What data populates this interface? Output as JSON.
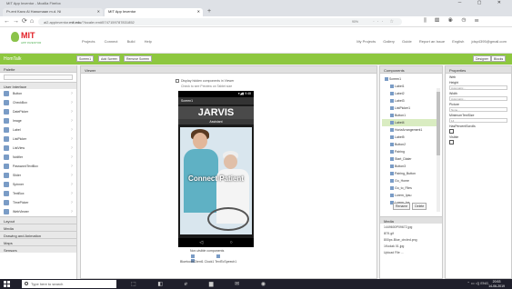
{
  "browser": {
    "window_title": "MIT App Inventor - Mozilla Firefox",
    "tabs": [
      {
        "label": "Pr-ent Kavo Al Hanumaan m.d. Ni"
      },
      {
        "label": "MIT App Inventor"
      }
    ],
    "url_prefix": "ai2.appinventor.",
    "url_domain": "mit.edu",
    "url_suffix": "/?locale=en#5747159787831852",
    "url_badge": "90%"
  },
  "header": {
    "logo_title": "MIT",
    "logo_subtitle": "APP INVENTOR",
    "menus": [
      "Projects",
      "Connect",
      "Build",
      "Help"
    ],
    "right_links": [
      "My Projects",
      "Gallery",
      "Guide",
      "Report an Issue",
      "English",
      "jdsp4395@gmail.com"
    ]
  },
  "project_bar": {
    "project_name": "HomTalk",
    "buttons": [
      "Screen1",
      "Add Screen",
      "Remove Screen",
      "Designer",
      "Blocks"
    ]
  },
  "palette": {
    "title": "Palette",
    "category": "User Interface",
    "items": [
      {
        "label": "Button"
      },
      {
        "label": "CheckBox"
      },
      {
        "label": "DatePicker"
      },
      {
        "label": "Image"
      },
      {
        "label": "Label"
      },
      {
        "label": "ListPicker"
      },
      {
        "label": "ListView"
      },
      {
        "label": "Notifier"
      },
      {
        "label": "PasswordTextBox"
      },
      {
        "label": "Slider"
      },
      {
        "label": "Spinner"
      },
      {
        "label": "TextBox"
      },
      {
        "label": "TimePicker"
      },
      {
        "label": "WebViewer"
      }
    ],
    "categories_below": [
      "Layout",
      "Media",
      "Drawing and Animation",
      "Maps",
      "Sensors"
    ]
  },
  "viewer": {
    "title": "Viewer",
    "checkbox_label": "Display hidden components in Viewer",
    "size_label": "Check to see Preview on Tablet size",
    "status_time": "9:48",
    "screen_title": "Screen1",
    "heading": "JARVIS",
    "subheading": "Assistant",
    "image_caption": "Connect Patient",
    "nonvisible_title": "Non-visible components",
    "nonvisible_items": "BluetoothClient1  Clock1  TextToSpeech1"
  },
  "components": {
    "title": "Components",
    "root": "Screen1",
    "items": [
      "Label1",
      "Label2",
      "Label3",
      "ListPicker1",
      "Button1",
      "Label4",
      "HorizArrangement1",
      "Label5",
      "Button2",
      "Pairing",
      "Start_Dialer",
      "Button3",
      "Pairing_Button",
      "Go_Home",
      "Go_to_Files",
      "Lorem_Ipsu",
      "Lorem_Ips"
    ],
    "selected_index": 5,
    "rename_label": "Rename",
    "delete_label": "Delete",
    "media_title": "Media",
    "media_items": [
      "1449600P09672.jpg",
      "lll79.gif",
      "800px-Blue_circled.png",
      "1Kodak 01.jpg",
      "Upload File ..."
    ]
  },
  "properties": {
    "title": "Properties",
    "component": "Web",
    "fields": [
      {
        "label": "Height",
        "value": "Automatic..."
      },
      {
        "label": "Width",
        "value": "Automatic..."
      },
      {
        "label": "Picture",
        "value": "None..."
      },
      {
        "label": "MinimumTextSize",
        "value": "14"
      }
    ],
    "checkboxes": [
      {
        "label": "HasPercentScrolls"
      },
      {
        "label": "Visible"
      }
    ]
  },
  "taskbar": {
    "search_placeholder": "Type here to search",
    "tray": "ENG",
    "time": "20:53",
    "date": "14-06-2019"
  }
}
